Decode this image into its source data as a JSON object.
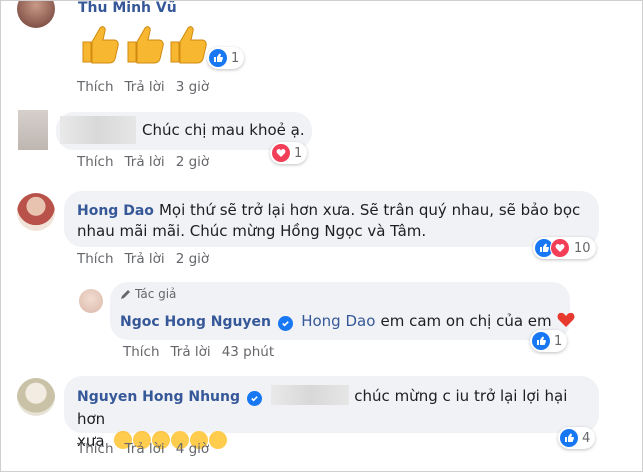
{
  "comments": [
    {
      "author": "Thu Minh Vũ",
      "text": "",
      "actions": [
        "Thích",
        "Trả lời",
        "3 giờ"
      ],
      "reaction_count": "1"
    },
    {
      "author": "",
      "text": "Chúc chị mau khoẻ ạ.",
      "actions": [
        "Thích",
        "Trả lời",
        "2 giờ"
      ],
      "reaction_count": "1"
    },
    {
      "author": "Hong Dao",
      "text": "Mọi thứ sẽ trở lại hơn xưa. Sẽ trân quý nhau, sẽ bảo bọc nhau mãi mãi. Chúc mừng Hồng Ngọc và Tâm.",
      "text_line1": "Mọi thứ sẽ trở lại hơn xưa. Sẽ trân quý nhau, sẽ bảo bọc",
      "text_line2": "nhau mãi mãi. Chúc mừng Hồng Ngọc và Tâm.",
      "actions": [
        "Thích",
        "Trả lời",
        "2 giờ"
      ],
      "reaction_count": "10"
    },
    {
      "badge": "Tác giả",
      "author": "Ngoc Hong Nguyen",
      "mention": "Hong Dao",
      "text": "em cam on chị của em",
      "actions": [
        "Thích",
        "Trả lời",
        "43 phút"
      ],
      "reaction_count": "1"
    },
    {
      "author": "Nguyen Hong Nhung",
      "text_line1": "chúc mừng c iu trở lại lợi hại hơn",
      "text_line2": "xưa",
      "actions": [
        "Thích",
        "Trả lời",
        "4 giờ"
      ],
      "reaction_count": "4"
    }
  ],
  "colors": {
    "link": "#365899",
    "bubble": "#f0f2f5",
    "like": "#1877f2",
    "love": "#f33e58",
    "meta": "#65676b"
  },
  "icons": [
    "thumbs-up-emoji",
    "like-icon",
    "love-icon",
    "verified-icon",
    "pen-icon",
    "laughing-emoji",
    "smiling-hearts-emoji"
  ]
}
